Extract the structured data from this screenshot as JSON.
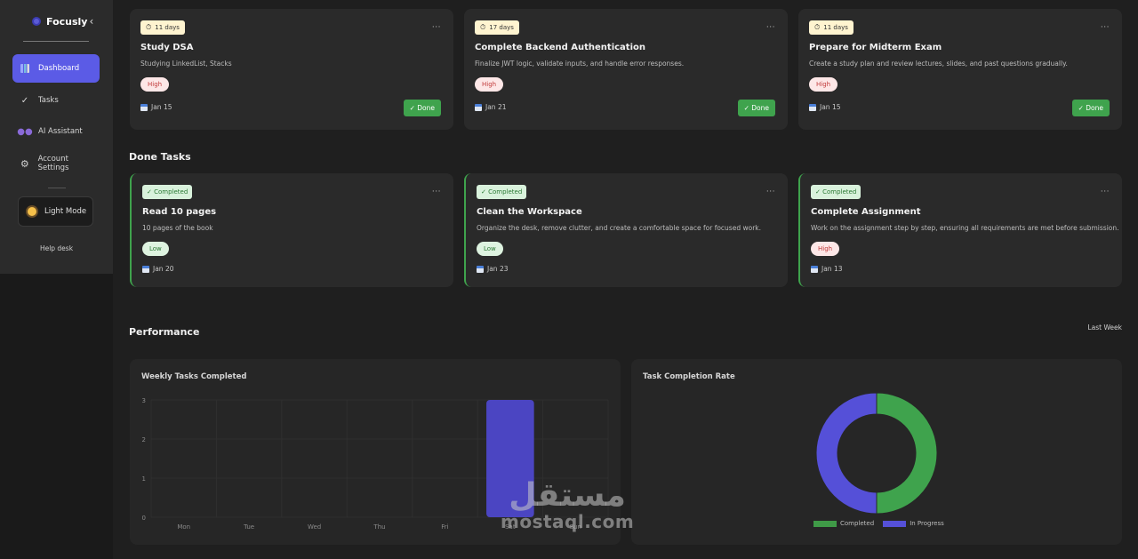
{
  "app": {
    "name": "Focusly",
    "collapse_glyph": "‹"
  },
  "sidebar": {
    "items": [
      {
        "label": "Dashboard",
        "icon": "chart-icon",
        "active": true
      },
      {
        "label": "Tasks",
        "icon": "check-icon"
      },
      {
        "label": "AI Assistant",
        "icon": "ai-icon"
      },
      {
        "label": "Account Settings",
        "icon": "gear-icon"
      }
    ],
    "mode_label": "Light Mode",
    "help_label": "Help desk"
  },
  "todo_cards": [
    {
      "days": "11 days",
      "title": "Study DSA",
      "desc": "Studying LinkedList, Stacks",
      "priority": "High",
      "date": "Jan 15",
      "action": "✓ Done"
    },
    {
      "days": "17 days",
      "title": "Complete Backend Authentication",
      "desc": "Finalize JWT logic, validate inputs, and handle error responses.",
      "priority": "High",
      "date": "Jan 21",
      "action": "✓ Done"
    },
    {
      "days": "11 days",
      "title": "Prepare for Midterm Exam",
      "desc": "Create a study plan and review lectures, slides, and past questions gradually.",
      "priority": "High",
      "date": "Jan 15",
      "action": "✓ Done"
    }
  ],
  "done_section": {
    "title": "Done Tasks"
  },
  "done_cards": [
    {
      "badge": "✓ Completed",
      "title": "Read 10 pages",
      "desc": "10 pages of the book",
      "priority": "Low",
      "date": "Jan 20"
    },
    {
      "badge": "✓ Completed",
      "title": "Clean the Workspace",
      "desc": "Organize the desk, remove clutter, and create a comfortable space for focused work.",
      "priority": "Low",
      "date": "Jan 23"
    },
    {
      "badge": "✓ Completed",
      "title": "Complete Assignment",
      "desc": "Work on the assignment step by step, ensuring all requirements are met before submission.",
      "priority": "High",
      "date": "Jan 13"
    }
  ],
  "performance": {
    "title": "Performance",
    "range": "Last Week"
  },
  "colors": {
    "accent": "#5b5be6",
    "done": "#3fa34d",
    "bar": "#4b45c2",
    "progress": "#5550d8"
  },
  "chart_data": [
    {
      "type": "bar",
      "title": "Weekly Tasks Completed",
      "categories": [
        "Mon",
        "Tue",
        "Wed",
        "Thu",
        "Fri",
        "Sat",
        "Sun"
      ],
      "values": [
        0,
        0,
        0,
        0,
        0,
        3,
        0
      ],
      "ylim": [
        0,
        3
      ],
      "yticks": [
        0,
        1,
        2,
        3
      ],
      "grid": true
    },
    {
      "type": "pie",
      "title": "Task Completion Rate",
      "series": [
        {
          "name": "Completed",
          "value": 3
        },
        {
          "name": "In Progress",
          "value": 3
        }
      ],
      "legend": "bottom"
    }
  ],
  "watermark": {
    "arabic": "مستقل",
    "latin": "mostaql.com"
  }
}
